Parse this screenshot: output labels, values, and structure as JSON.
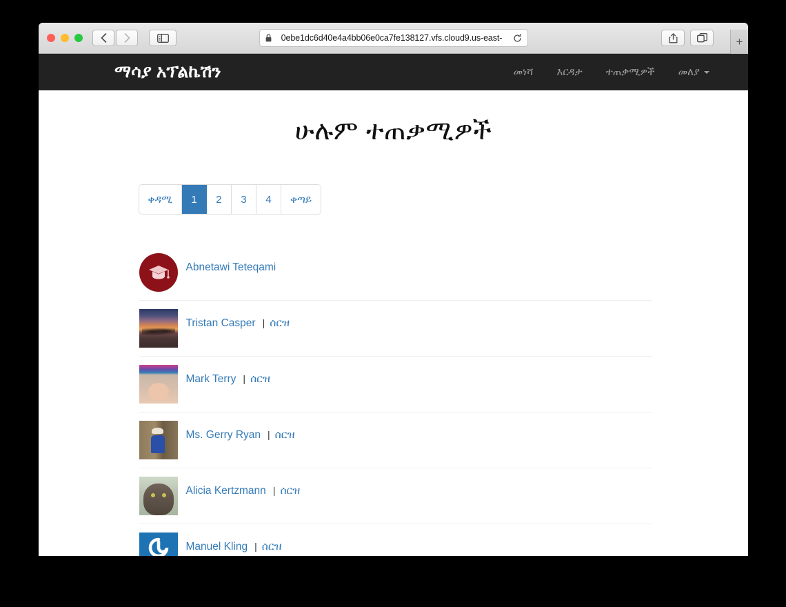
{
  "browser": {
    "url": "0ebe1dc6d40e4a4bb06e0ca7fe138127.vfs.cloud9.us-east-",
    "back_label": "‹",
    "forward_label": "›",
    "new_tab_label": "+",
    "icons": {
      "lock": "lock-icon",
      "reload": "reload-icon",
      "sidebar": "sidebar-toggle-icon",
      "share": "share-icon",
      "tabs": "tabs-icon"
    }
  },
  "navbar": {
    "brand": "ማሳያ አፕልኬሽን",
    "links": [
      {
        "label": "መነሻ",
        "has_caret": false
      },
      {
        "label": "እርዳታ",
        "has_caret": false
      },
      {
        "label": "ተጠቃሚዎች",
        "has_caret": false
      },
      {
        "label": "መለያ",
        "has_caret": true
      }
    ]
  },
  "page": {
    "title": "ሁሉም ተጠቃሚዎች"
  },
  "pagination": {
    "prev_label": "ቀዳሚ",
    "next_label": "ቀጣይ",
    "pages": [
      "1",
      "2",
      "3",
      "4"
    ],
    "active_page": "1"
  },
  "users": [
    {
      "name": "Abnetawi Teteqami",
      "delete_label": "",
      "separator": "",
      "avatar": "graduation-cap-badge"
    },
    {
      "name": "Tristan Casper",
      "delete_label": "ሰርዝ",
      "separator": "|",
      "avatar": "sunset-photo"
    },
    {
      "name": "Mark Terry",
      "delete_label": "ሰርዝ",
      "separator": "|",
      "avatar": "baby-photo"
    },
    {
      "name": "Ms. Gerry Ryan",
      "delete_label": "ሰርዝ",
      "separator": "|",
      "avatar": "person-blue-shirt-photo"
    },
    {
      "name": "Alicia Kertzmann",
      "delete_label": "ሰርዝ",
      "separator": "|",
      "avatar": "cat-photo"
    },
    {
      "name": "Manuel Kling",
      "delete_label": "ሰርዝ",
      "separator": "|",
      "avatar": "gravatar-logo"
    }
  ],
  "colors": {
    "navbar_bg": "#222222",
    "link_blue": "#337ab7",
    "active_page_bg": "#337ab7",
    "badge_maroon": "#8c1118",
    "gravatar_blue": "#1d73b3"
  }
}
